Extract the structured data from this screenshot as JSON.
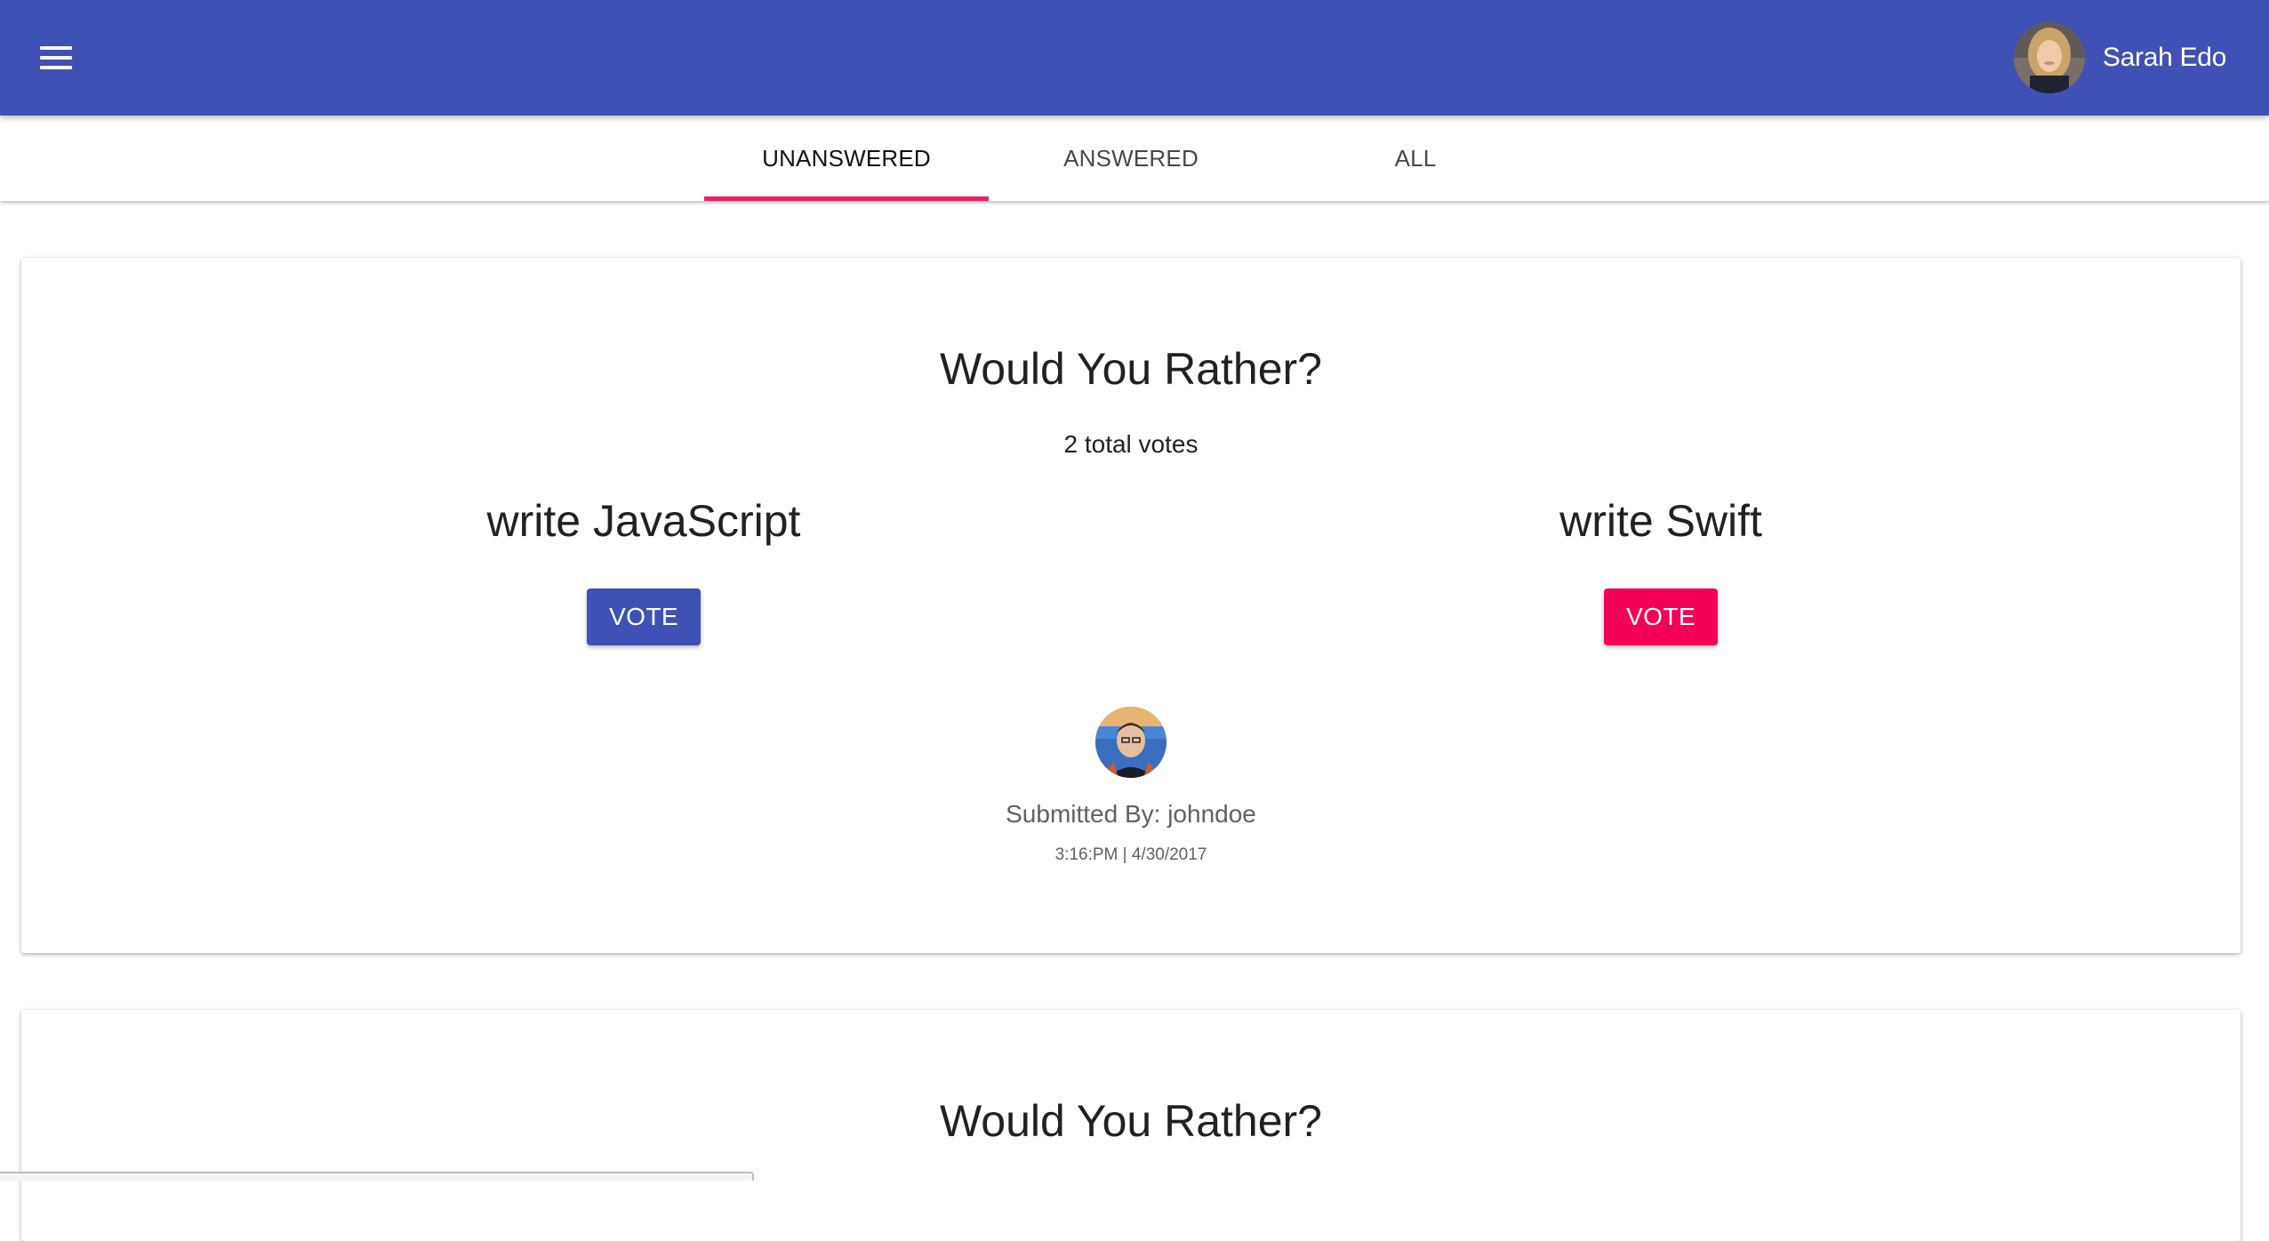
{
  "appbar": {
    "menu_icon": "hamburger-menu-icon",
    "user_name": "Sarah Edo",
    "colors": {
      "background": "#3f51b5",
      "text": "#ffffff"
    }
  },
  "tabs": [
    {
      "label": "UNANSWERED",
      "active": true
    },
    {
      "label": "ANSWERED",
      "active": false
    },
    {
      "label": "ALL",
      "active": false
    }
  ],
  "accent_color": "#ec1f61",
  "questions": [
    {
      "title": "Would You Rather?",
      "total_votes": "2 total votes",
      "option_a": {
        "text": "write JavaScript",
        "button": "VOTE",
        "color": "#3f51b5"
      },
      "option_b": {
        "text": "write Swift",
        "button": "VOTE",
        "color": "#f50057"
      },
      "submitted_by": "Submitted By: johndoe",
      "timestamp": "3:16:PM | 4/30/2017"
    },
    {
      "title": "Would You Rather?"
    }
  ]
}
